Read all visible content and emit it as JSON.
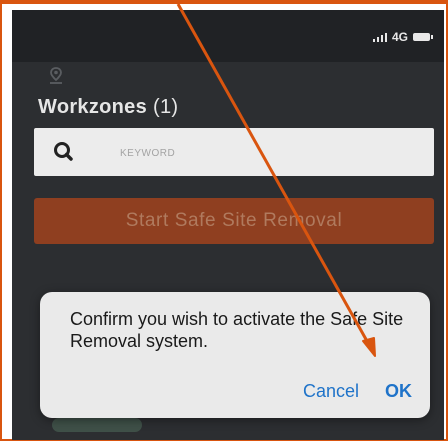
{
  "status_bar": {
    "network": "4G"
  },
  "header": {
    "app_icon": "location-pin-icon",
    "title": "Workzones",
    "count": "(1)"
  },
  "search": {
    "icon": "search-icon",
    "placeholder": "KEYWORD"
  },
  "main": {
    "start_button_label": "Start Safe Site Removal"
  },
  "dialog": {
    "message": "Confirm you wish to activate the Safe Site Removal system.",
    "cancel_label": "Cancel",
    "ok_label": "OK"
  },
  "annotation": {
    "shape": "arrow",
    "color": "#d9550f"
  },
  "colors": {
    "accent": "#d9550f",
    "start_button": "#8f3f20",
    "dialog_button_text": "#1f73c9",
    "background": "#2c2e31"
  }
}
